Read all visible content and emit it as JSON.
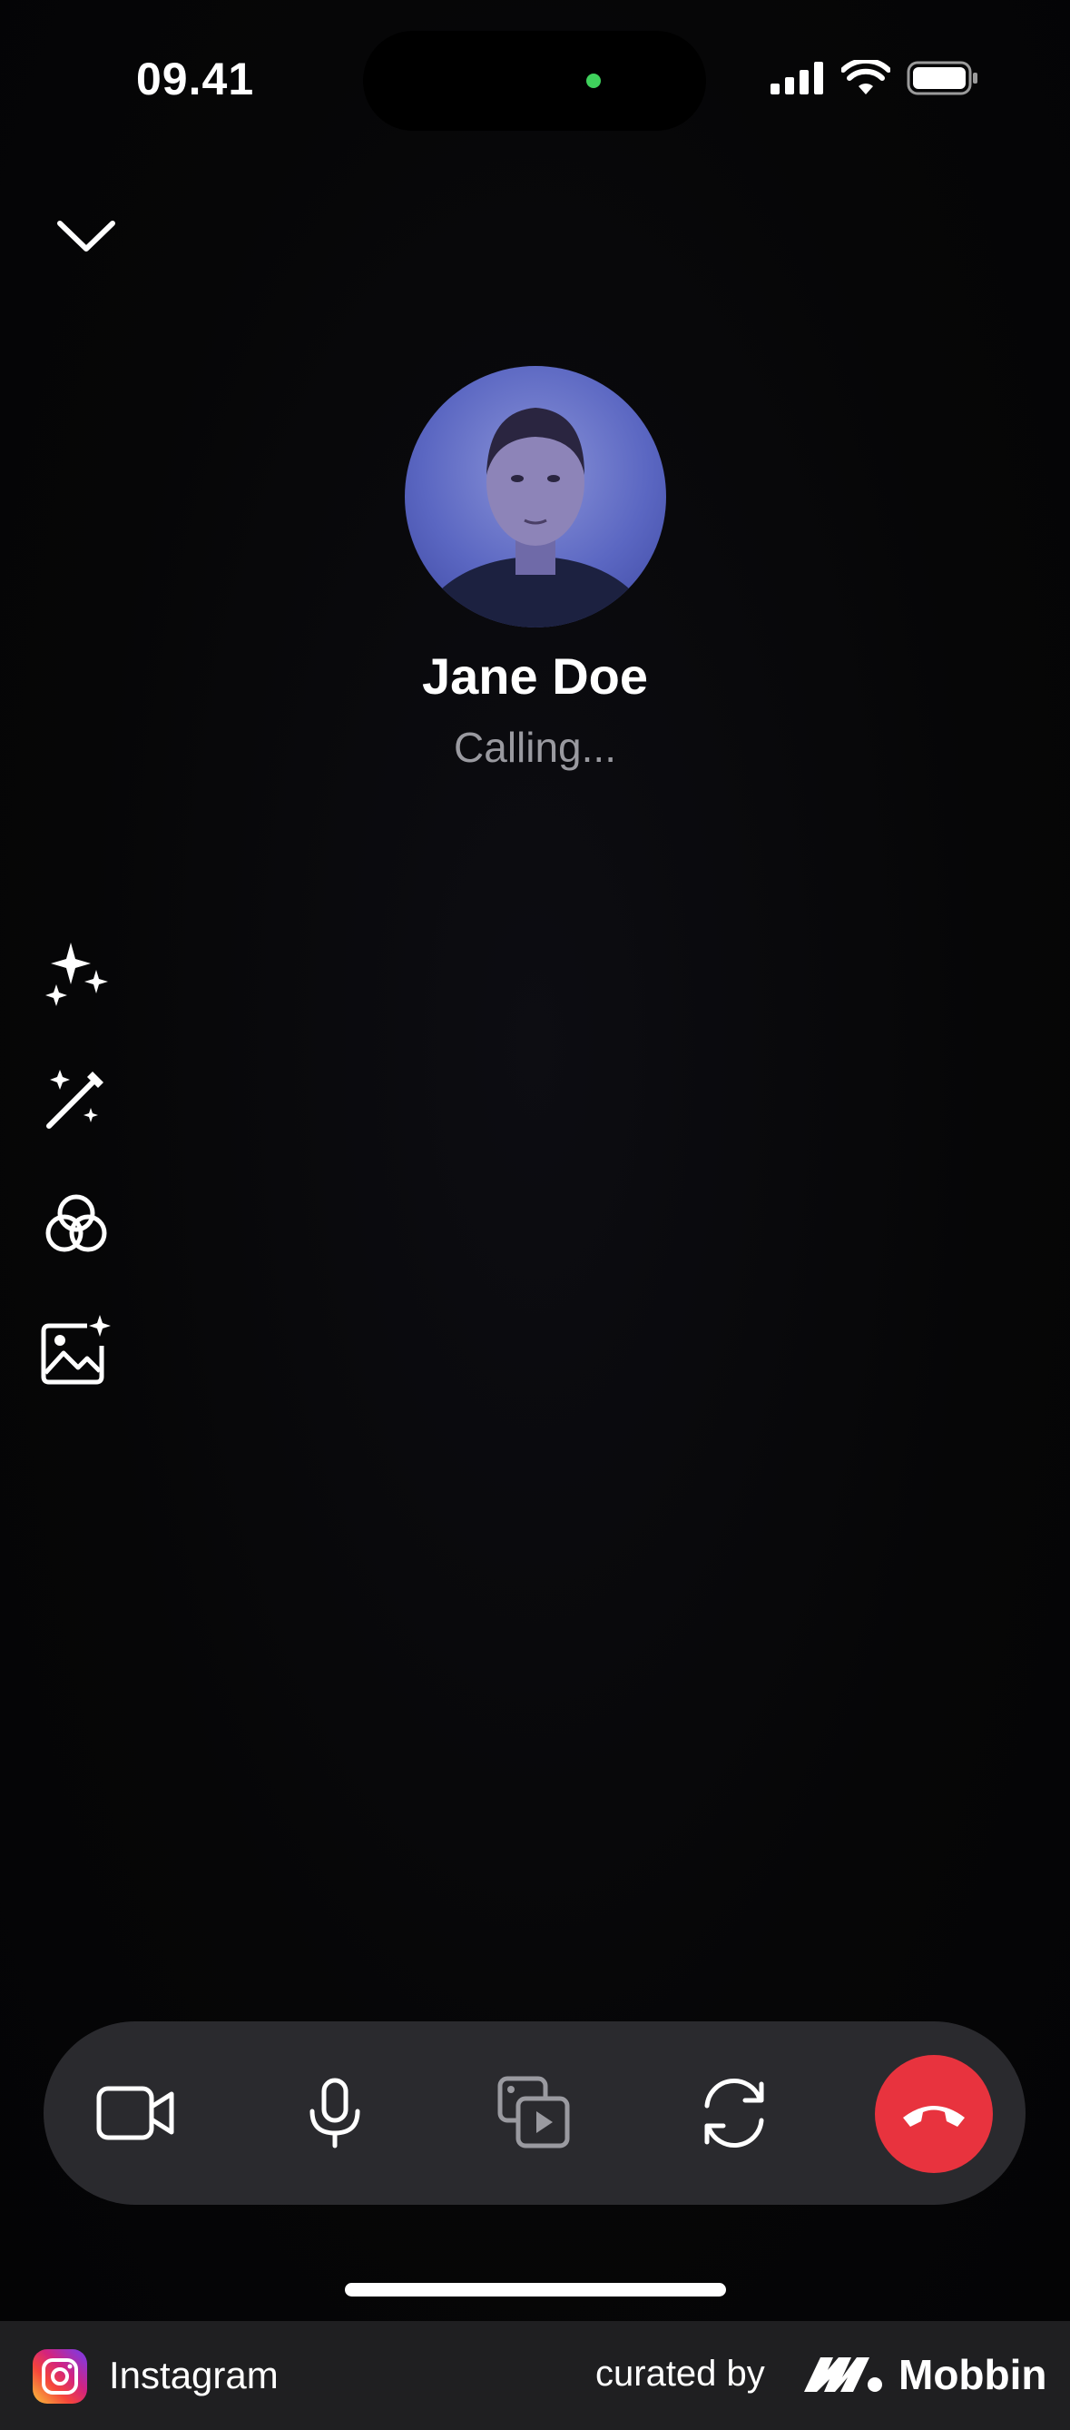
{
  "status_bar": {
    "time": "09.41"
  },
  "caller": {
    "name": "Jane Doe",
    "status": "Calling..."
  },
  "icons": {
    "collapse": "chevron-down-icon",
    "effects": "sparkles-icon",
    "magic": "magic-wand-icon",
    "filters": "filters-icon",
    "backgrounds": "image-sparkle-icon",
    "video": "video-camera-icon",
    "mic": "microphone-icon",
    "share": "media-share-icon",
    "flip": "flip-camera-icon",
    "end": "end-call-icon"
  },
  "colors": {
    "end_call": "#e8333e",
    "control_bar": "#2a2a2e",
    "status_text": "#9a9aa0"
  },
  "footer": {
    "app_name": "Instagram",
    "curated_by": "curated by",
    "brand": "Mobbin"
  }
}
